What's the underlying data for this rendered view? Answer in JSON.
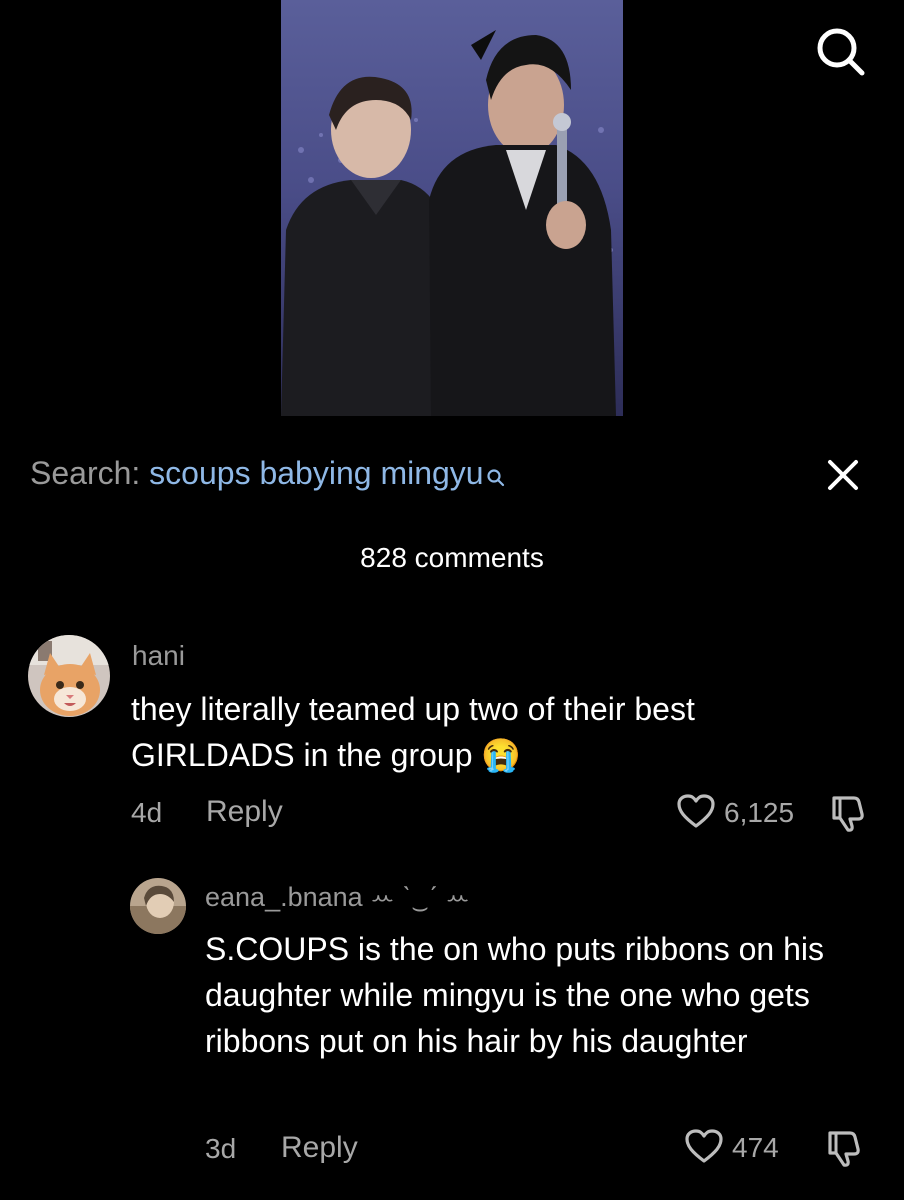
{
  "search": {
    "prefix": "Search: ",
    "query": "scoups babying mingyu"
  },
  "comments_header": {
    "count_label": "828 comments"
  },
  "comments": [
    {
      "username": "hani",
      "text": "they literally teamed up two of their best GIRLDADS in the group 😭",
      "age": "4d",
      "reply_label": "Reply",
      "likes": "6,125"
    },
    {
      "username": "eana_.bnana ꕀ ˋ‿ˊ ꕀ",
      "text": "S.COUPS is the on who puts ribbons on his daughter while mingyu is the one who gets ribbons put on his hair by his daughter",
      "age": "3d",
      "reply_label": "Reply",
      "likes": "474"
    }
  ],
  "icons": {
    "top_search": "search-icon",
    "inline_search": "search-icon",
    "close": "close-icon",
    "like": "heart-icon",
    "dislike": "thumbs-down-icon"
  },
  "colors": {
    "background": "#000000",
    "search_query": "#8fb8e6",
    "muted_text": "#a8a8a8"
  }
}
